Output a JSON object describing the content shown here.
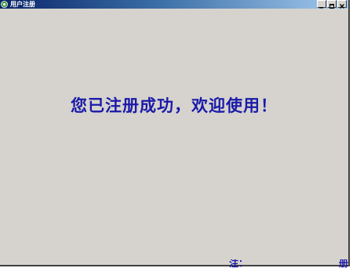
{
  "window": {
    "title": "用户注册",
    "icon": "app-icon",
    "buttons": [
      "minimize-icon",
      "maximize-icon",
      "close-icon"
    ]
  },
  "content": {
    "message": "您已注册成功，欢迎使用！"
  },
  "footer": {
    "left_text": "注：",
    "right_text": "册"
  },
  "colors": {
    "window_bg": "#d6d3ce",
    "message_text": "#1a1aa8",
    "titlebar_start": "#0a246a",
    "titlebar_end": "#a6caf0"
  }
}
